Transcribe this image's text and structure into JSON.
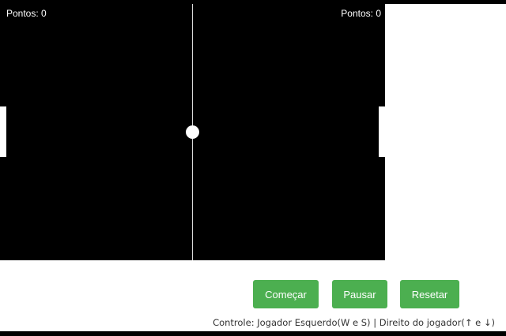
{
  "scoreboard": {
    "left_score": "Pontos: 0",
    "right_score": "Pontos: 0"
  },
  "buttons": {
    "start_label": "Começar",
    "pause_label": "Pausar",
    "reset_label": "Resetar"
  },
  "controls_hint": "Controle: Jogador Esquerdo(W e S) | Direito do jogador(↑ e ↓)",
  "colors": {
    "canvas_background": "#000000",
    "game_elements": "#ffffff",
    "button_background": "#4caf50",
    "button_text": "#ffffff"
  }
}
